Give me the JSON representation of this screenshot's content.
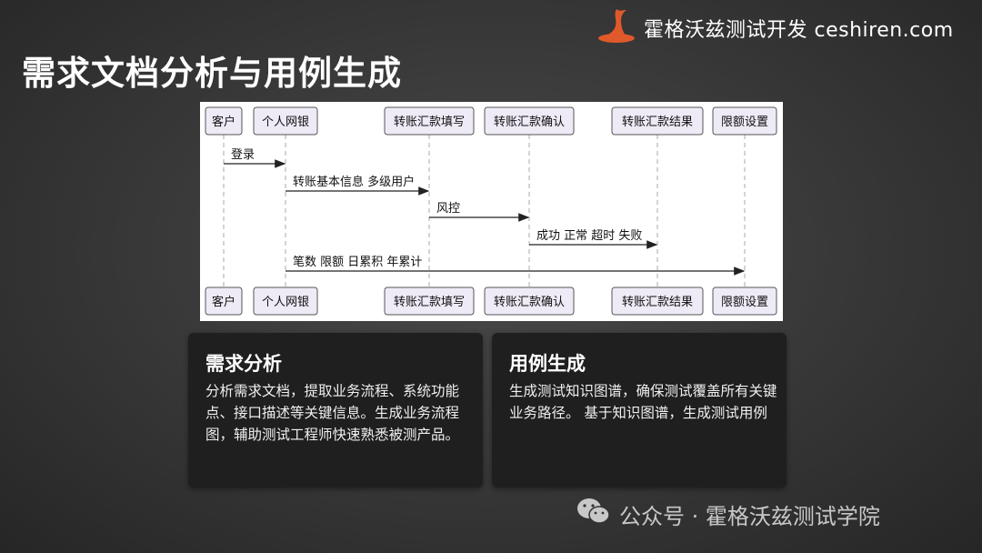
{
  "brand": {
    "text": "霍格沃兹测试开发 ceshiren.com",
    "logo_icon": "wizard-hat-icon",
    "logo_color": "#e0592a"
  },
  "title": "需求文档分析与用例生成",
  "diagram": {
    "participants": [
      "客户",
      "个人网银",
      "转账汇款填写",
      "转账汇款确认",
      "转账汇款结果",
      "限额设置"
    ],
    "messages": [
      {
        "from": 0,
        "to": 1,
        "label": "登录"
      },
      {
        "from": 1,
        "to": 2,
        "label": "转账基本信息 多级用户"
      },
      {
        "from": 2,
        "to": 3,
        "label": "风控"
      },
      {
        "from": 3,
        "to": 4,
        "label": "成功 正常 超时 失败"
      },
      {
        "from": 1,
        "to": 5,
        "label": "笔数 限额 日累积 年累计"
      }
    ]
  },
  "cards": {
    "left": {
      "title": "需求分析",
      "body": "分析需求文档，提取业务流程、系统功能点、接口描述等关键信息。生成业务流程图，辅助测试工程师快速熟悉被测产品。"
    },
    "right": {
      "title": "用例生成",
      "body": "生成测试知识图谱，确保测试覆盖所有关键业务路径。 基于知识图谱，生成测试用例"
    }
  },
  "footer": {
    "text": "公众号 · 霍格沃兹测试学院",
    "icon": "wechat-icon"
  }
}
